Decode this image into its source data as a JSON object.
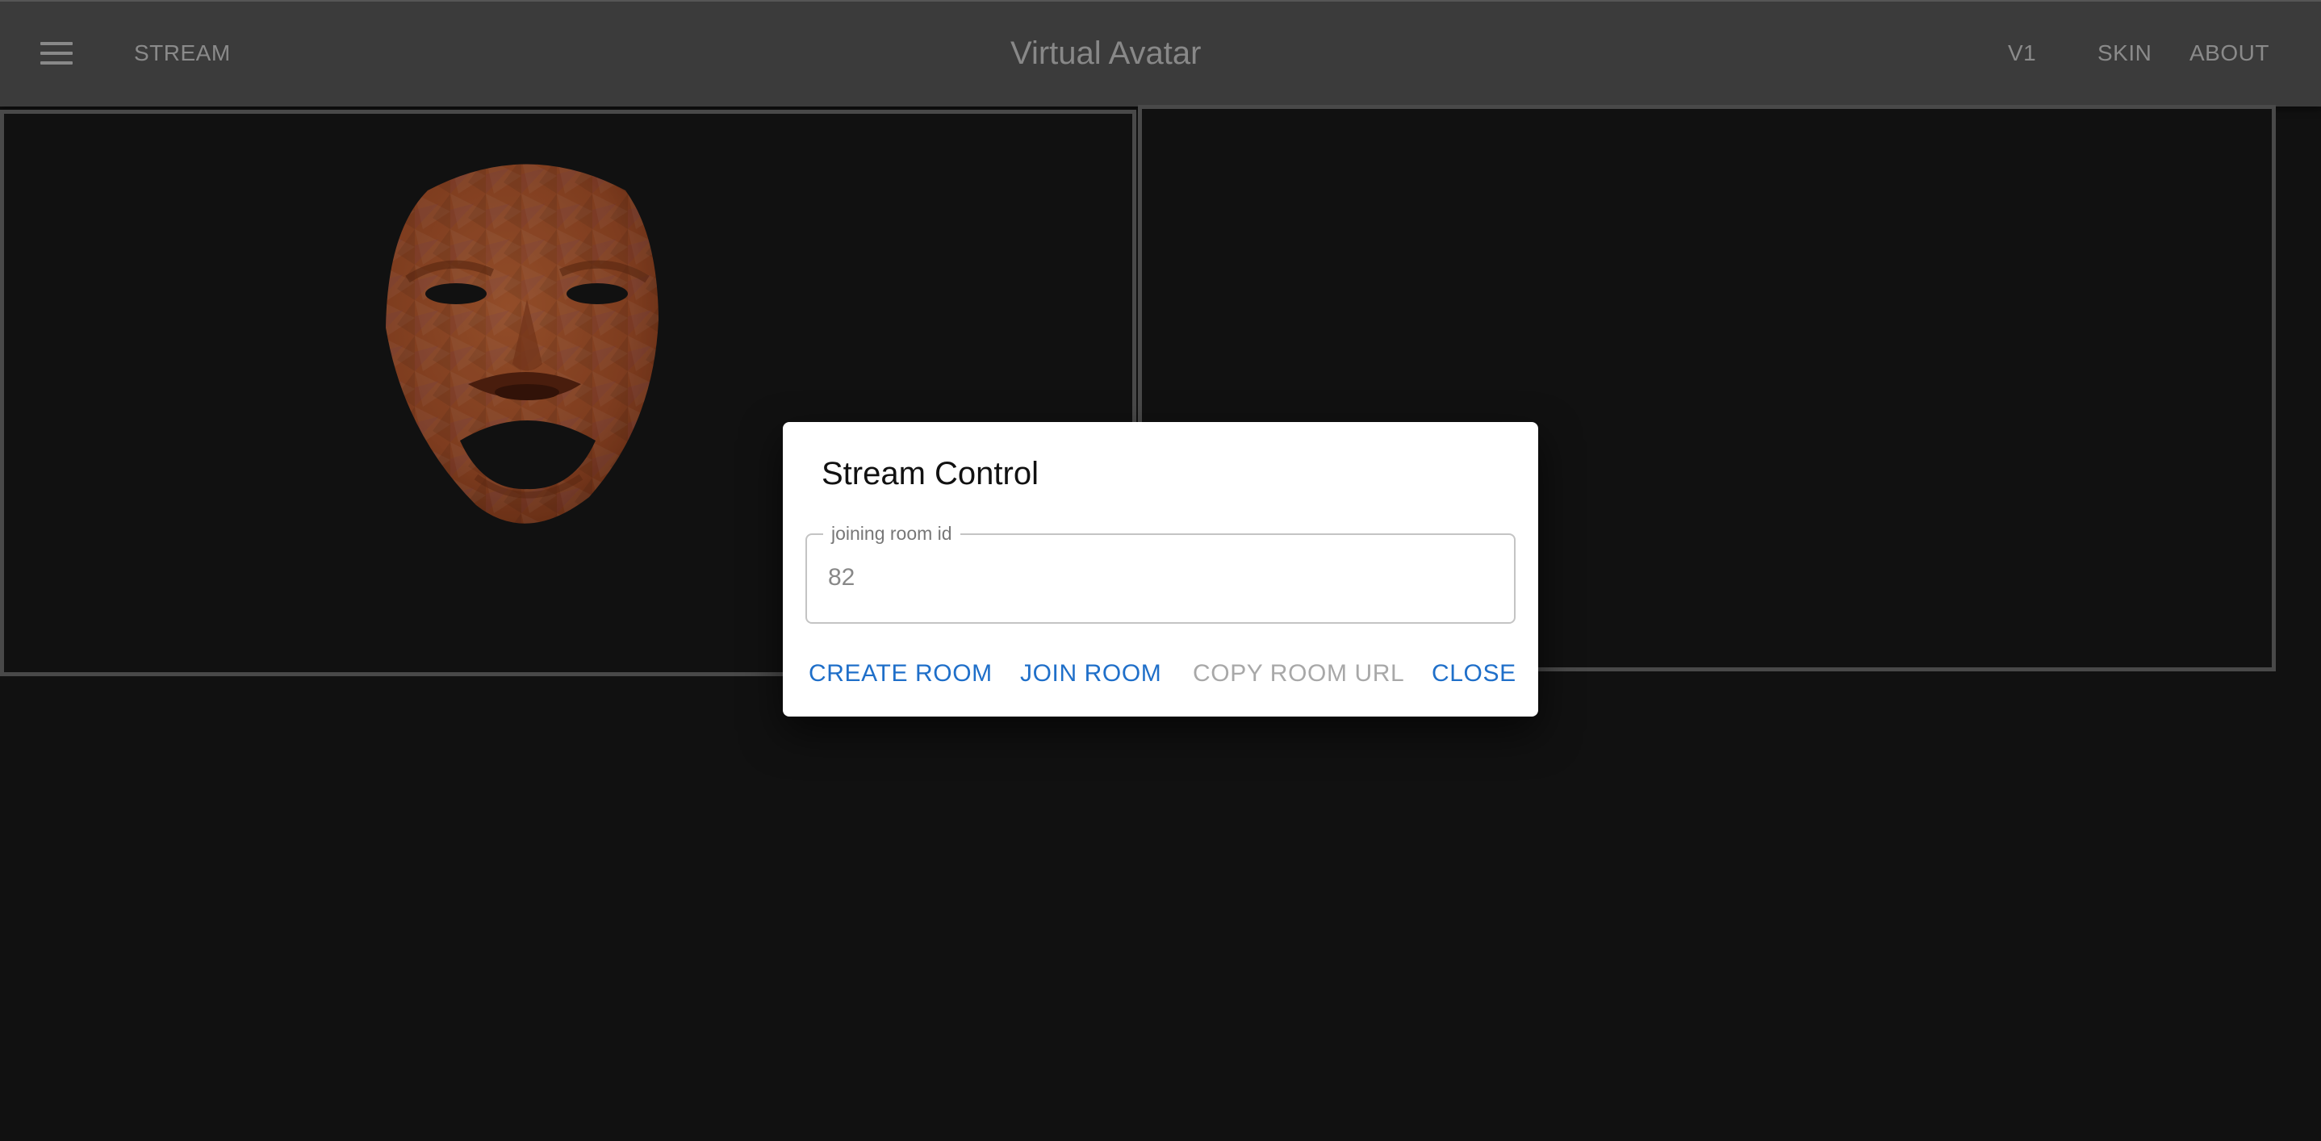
{
  "appbar": {
    "title": "Virtual Avatar",
    "stream_label": "STREAM",
    "v1_label": "V1",
    "skin_label": "SKIN",
    "about_label": "ABOUT",
    "menu_icon": "hamburger-menu-icon"
  },
  "dialog": {
    "title": "Stream Control",
    "room_field": {
      "label": "joining room id",
      "value": "82"
    },
    "actions": {
      "create_room": "CREATE ROOM",
      "join_room": "JOIN ROOM",
      "copy_room_url": "COPY ROOM URL",
      "close": "CLOSE"
    }
  },
  "colors": {
    "appbar_bg": "#494949",
    "page_bg": "#151515",
    "accent": "#1f6fc9",
    "disabled": "#a8a8a8",
    "avatar_skin": "#a3502a"
  }
}
